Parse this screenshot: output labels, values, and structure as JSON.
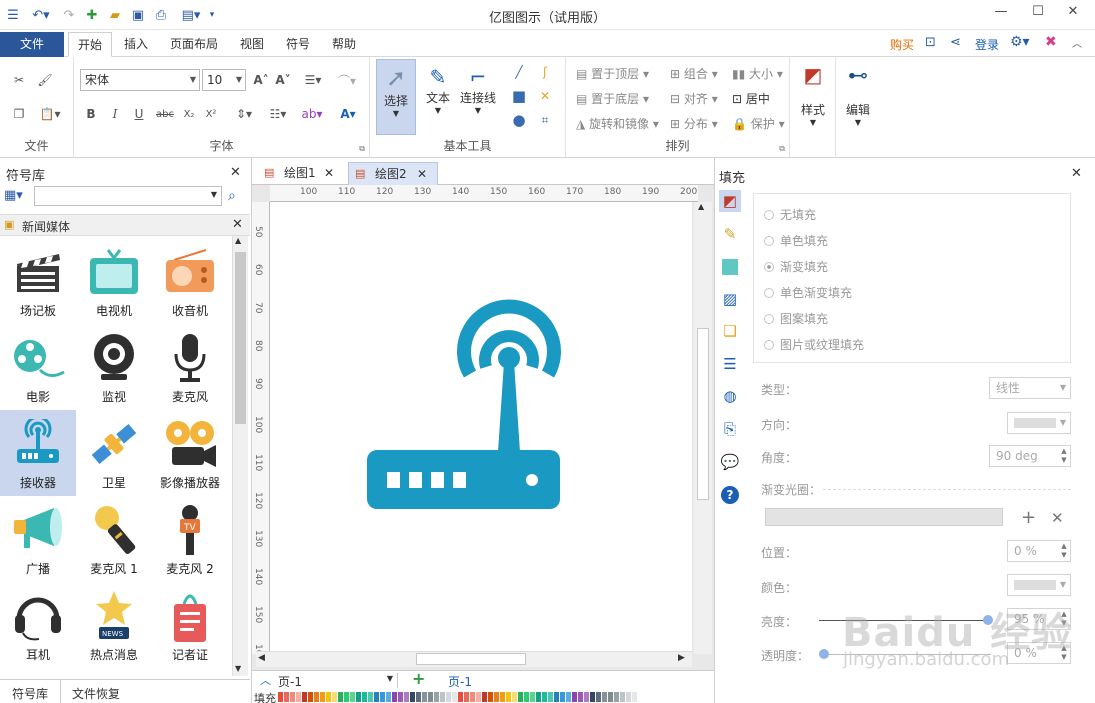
{
  "app": {
    "title": "亿图图示（试用版）"
  },
  "menu": {
    "file": "文件",
    "tabs": [
      "开始",
      "插入",
      "页面布局",
      "视图",
      "符号",
      "帮助"
    ],
    "buy": "购买",
    "login": "登录"
  },
  "ribbon": {
    "font_name": "宋体",
    "font_size": "10",
    "groups": {
      "file": "文件",
      "font": "字体",
      "basic_tools": "基本工具",
      "arrange": "排列"
    },
    "tools": {
      "select": "选择",
      "text": "文本",
      "connector": "连接线"
    },
    "arrange": {
      "to_top": "置于顶层",
      "group": "组合",
      "size": "大小",
      "to_bottom": "置于底层",
      "align": "对齐",
      "center": "居中",
      "rotate": "旋转和镜像",
      "distribute": "分布",
      "protect": "保护"
    },
    "style": "样式",
    "edit": "编辑"
  },
  "library": {
    "title": "符号库",
    "category": "新闻媒体",
    "symbols": [
      "场记板",
      "电视机",
      "收音机",
      "电影",
      "监视",
      "麦克风",
      "接收器",
      "卫星",
      "影像播放器",
      "广播",
      "麦克风 1",
      "麦克风 2",
      "耳机",
      "热点消息",
      "记者证"
    ],
    "selected": "接收器",
    "bottom_tabs": [
      "符号库",
      "文件恢复"
    ]
  },
  "doc_tabs": [
    "绘图1",
    "绘图2"
  ],
  "ruler": {
    "h": [
      "100",
      "110",
      "120",
      "130",
      "140",
      "150",
      "160",
      "170",
      "180",
      "190",
      "200"
    ],
    "v": [
      "50",
      "60",
      "70",
      "80",
      "90",
      "100",
      "110",
      "120",
      "130",
      "140",
      "150",
      "160"
    ]
  },
  "pagebar": {
    "page_select": "页-1",
    "current": "页-1",
    "fill_label": "填充"
  },
  "fill_panel": {
    "title": "填充",
    "options": [
      "无填充",
      "单色填充",
      "渐变填充",
      "单色渐变填充",
      "图案填充",
      "图片或纹理填充"
    ],
    "selected_option": "渐变填充",
    "type_label": "类型：",
    "type_value": "线性",
    "direction_label": "方向：",
    "angle_label": "角度：",
    "angle_value": "90 deg",
    "aperture_label": "渐变光圈：",
    "position_label": "位置：",
    "position_value": "0 %",
    "color_label": "颜色：",
    "brightness_label": "亮度：",
    "brightness_value": "95 %",
    "transparency_label": "透明度：",
    "transparency_value": "0 %"
  },
  "watermark": {
    "logo": "Baidu 经验",
    "url": "jingyan.baidu.com"
  },
  "colors": {
    "accent": "#2b579a",
    "icon_blue": "#1a99c3",
    "selection": "#c9d6ee"
  }
}
